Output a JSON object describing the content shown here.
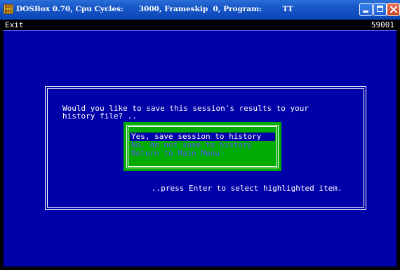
{
  "window": {
    "title": "DOSBox 0.70, Cpu Cycles:      3000, Frameskip  0, Program:        TT",
    "icon_label": "DOS BOX"
  },
  "dos_screen": {
    "top_left": "Exit",
    "top_right": "59001",
    "question_line1": "Would you like to save this session's results to your",
    "question_line2": "history file? ..",
    "menu": [
      {
        "label": "Yes, save session to history",
        "highlighted": true
      },
      {
        "label": "No, do not save to history",
        "highlighted": false
      },
      {
        "label": "Return to Main Menu",
        "highlighted": false
      }
    ],
    "hint": "..press Enter to select highlighted item."
  },
  "colors": {
    "screen_bg": "#0000a8",
    "menu_bg": "#00aa00",
    "highlight_bg": "#0000a8",
    "unselected_text": "#5555ff",
    "titlebar": "#1656c6"
  },
  "icons": [
    "dosbox-icon",
    "minimize-icon",
    "maximize-icon",
    "close-icon"
  ]
}
